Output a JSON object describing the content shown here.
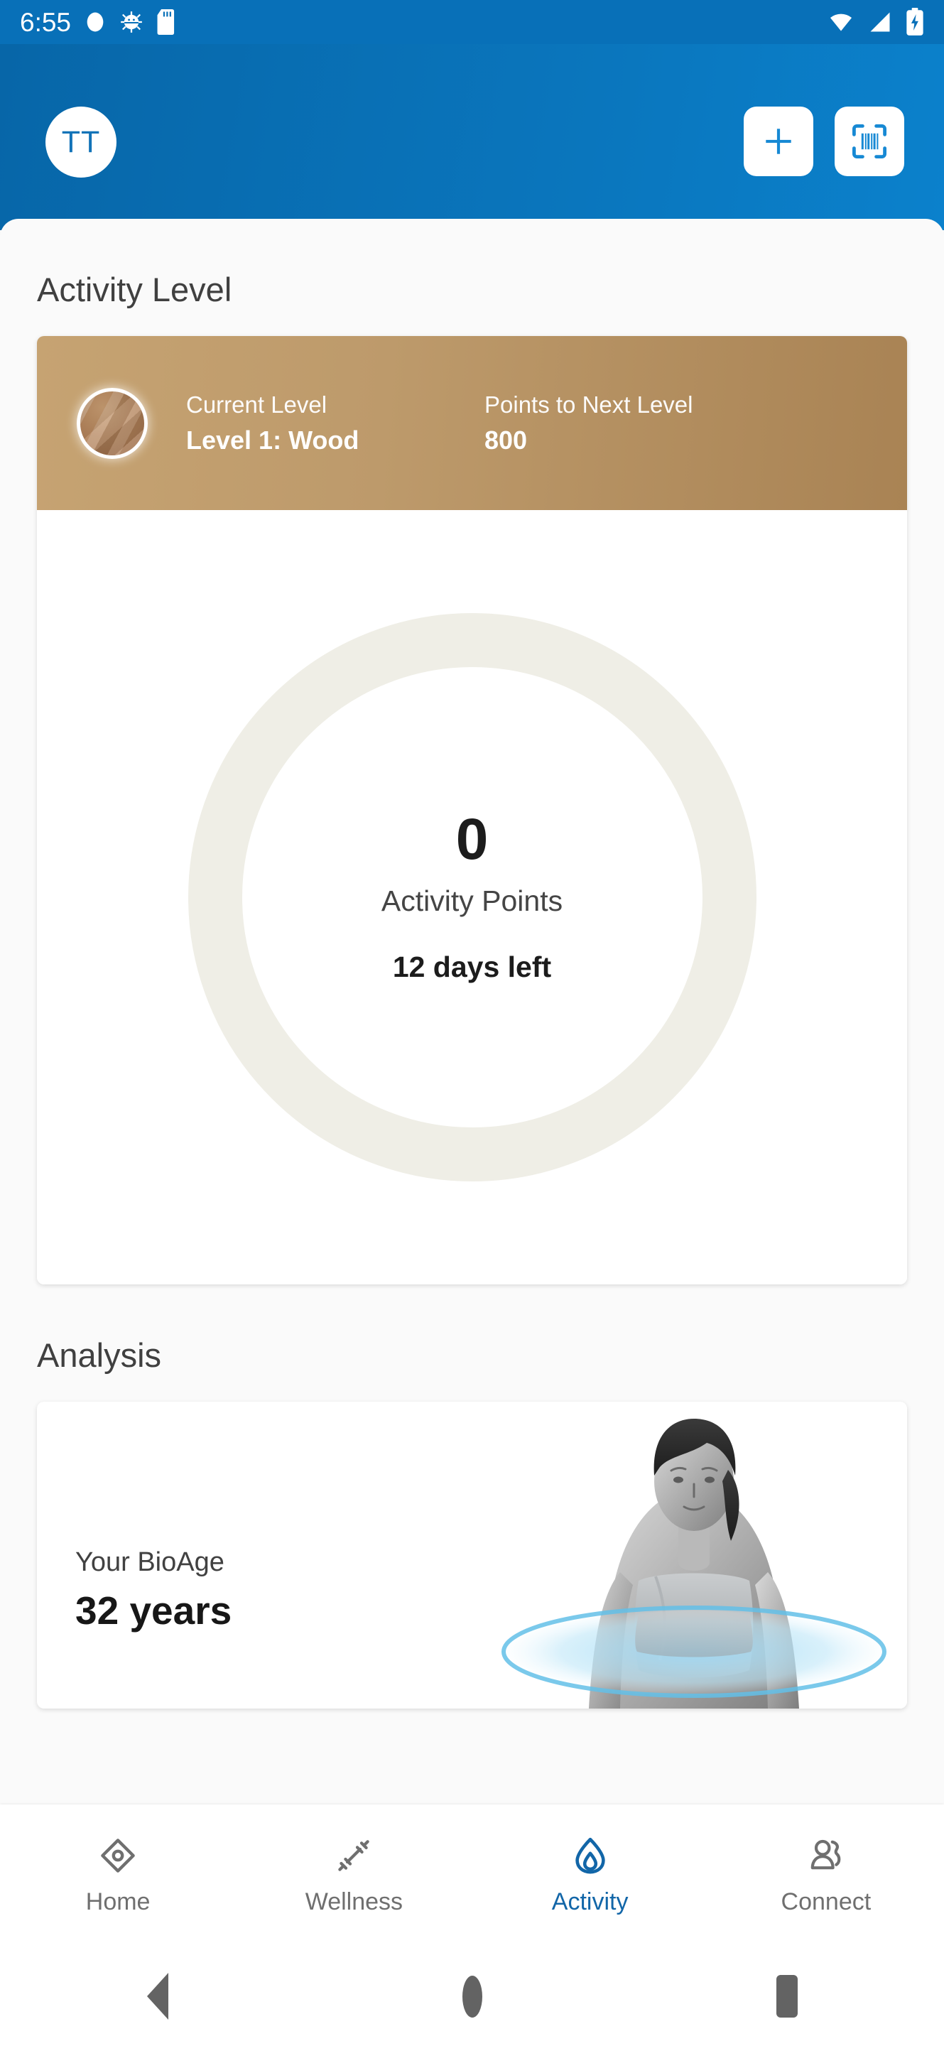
{
  "status_bar": {
    "time": "6:55",
    "icons_left": [
      "circle-dot-icon",
      "android-bug-icon",
      "sd-card-icon"
    ],
    "icons_right": [
      "wifi-icon",
      "cellular-signal-icon",
      "battery-charging-icon"
    ],
    "background_color": "#0870b8"
  },
  "app_bar": {
    "avatar_initials": "TT",
    "add_button_label": "add-icon",
    "scan_button_label": "barcode-scan-icon",
    "brand_color": "#0a76bd"
  },
  "activity_level": {
    "section_title": "Activity Level",
    "current_level_label": "Current Level",
    "current_level_value": "Level 1: Wood",
    "points_next_label": "Points to Next Level",
    "points_next_value": "800",
    "badge_icon": "wood-gem-badge-icon",
    "gradient_from": "#c6a372",
    "gradient_to": "#a98354"
  },
  "activity_ring": {
    "points": "0",
    "points_caption": "Activity Points",
    "days_left": "12 days left",
    "ring_color": "#efeee6",
    "progress_percent": 0
  },
  "analysis": {
    "section_title": "Analysis",
    "bioage_label": "Your BioAge",
    "bioage_value": "32 years",
    "photo_alt": "fitness-woman-scan-photo"
  },
  "bottom_nav": {
    "active_index": 2,
    "active_color": "#1266a8",
    "inactive_color": "#6f6f6f",
    "items": [
      {
        "label": "Home",
        "icon": "home-diamond-icon"
      },
      {
        "label": "Wellness",
        "icon": "dumbbell-icon"
      },
      {
        "label": "Activity",
        "icon": "flame-icon"
      },
      {
        "label": "Connect",
        "icon": "people-icon"
      }
    ]
  },
  "android_nav": {
    "back": "back-triangle-icon",
    "home": "home-pill-icon",
    "recents": "recents-square-icon"
  }
}
